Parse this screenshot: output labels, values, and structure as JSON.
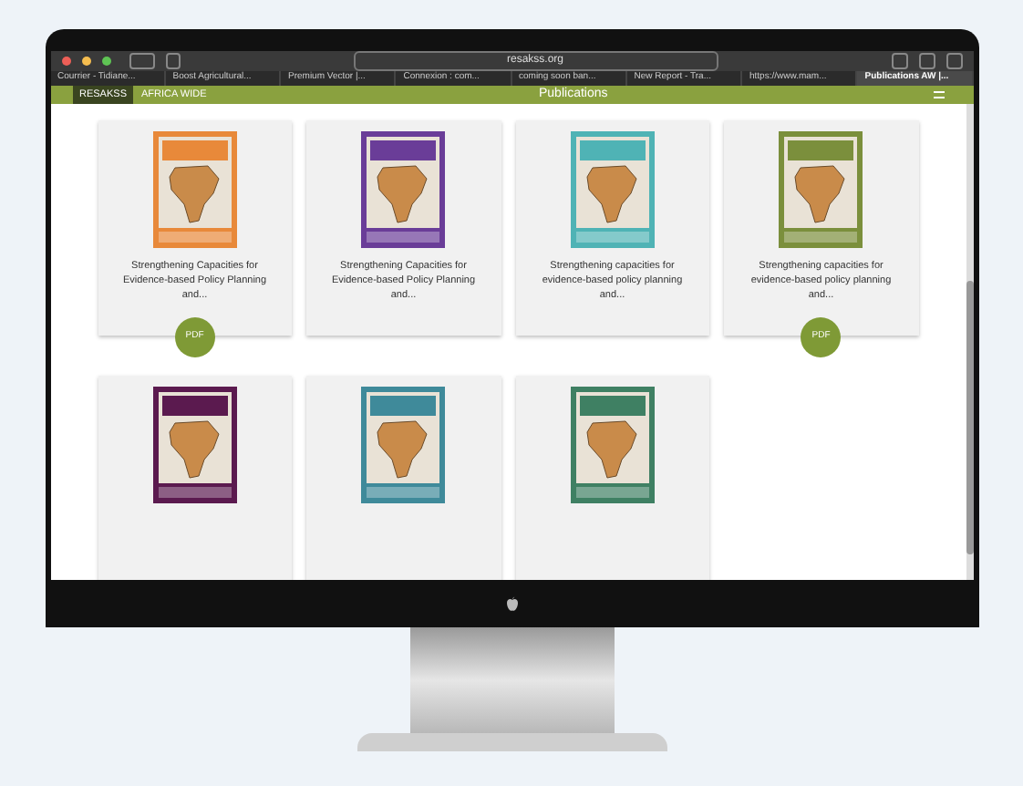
{
  "browser": {
    "address": "resakss.org",
    "tabs": [
      {
        "label": "Courrier - Tidiane...",
        "selected": false
      },
      {
        "label": "Boost Agricultural...",
        "selected": false
      },
      {
        "label": "Premium Vector |...",
        "selected": false
      },
      {
        "label": "Connexion : com...",
        "selected": false
      },
      {
        "label": "coming soon ban...",
        "selected": false
      },
      {
        "label": "New Report - Tra...",
        "selected": false
      },
      {
        "label": "https://www.mam...",
        "selected": false
      },
      {
        "label": "Publications AW |...",
        "selected": true
      }
    ]
  },
  "nav": {
    "brand": "RESAKSS",
    "section": "AFRICA WIDE",
    "title": "Publications"
  },
  "publications": [
    {
      "title": "Strengthening Capacities for Evidence-based Policy Planning and...",
      "color": "#e8893a",
      "pdf": "PDF"
    },
    {
      "title": "Strengthening Capacities for Evidence-based Policy Planning and...",
      "color": "#6a3d98"
    },
    {
      "title": "Strengthening capacities for evidence-based policy planning and...",
      "color": "#4fb3b5"
    },
    {
      "title": "Strengthening capacities for evidence-based policy planning and...",
      "color": "#7b8f3c",
      "pdf": "PDF"
    },
    {
      "color": "#5b1a4f"
    },
    {
      "color": "#3f8a9a"
    },
    {
      "color": "#3f8063"
    }
  ]
}
